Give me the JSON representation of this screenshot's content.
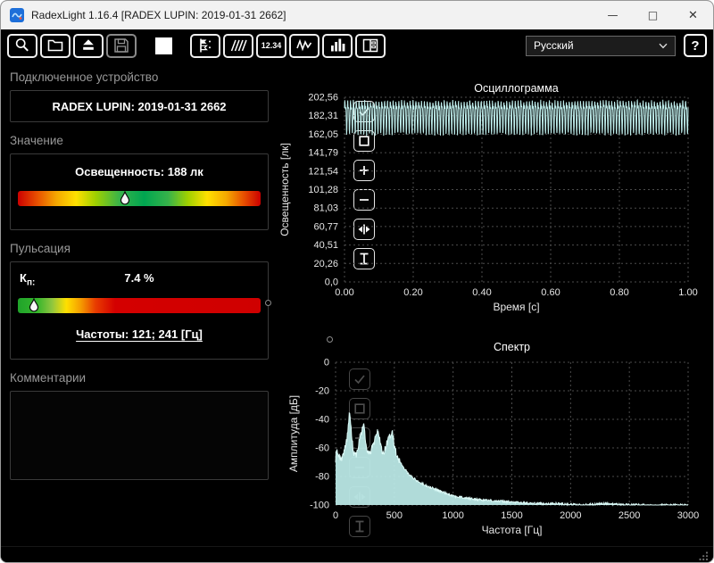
{
  "colors": {
    "accent_cyan": "#bfeeec",
    "grid": "#4c4c4c",
    "panel_header": "#989898",
    "titlebar_bg": "#f2f2f2",
    "scale_green": "#00a651",
    "scale_red": "#cc0000"
  },
  "window": {
    "title": "RadexLight 1.16.4 [RADEX LUPIN: 2019-01-31 2662]",
    "controls": {
      "minimize": "—",
      "maximize": "□",
      "close": "✕"
    }
  },
  "toolbar": {
    "buttons": [
      {
        "name": "search-device",
        "icon": "magnifier-icon"
      },
      {
        "name": "open-file",
        "icon": "folder-open-icon"
      },
      {
        "name": "eject-device",
        "icon": "eject-icon"
      },
      {
        "name": "save-file",
        "icon": "floppy-icon",
        "disabled": true
      },
      {
        "name": "stop-measurement",
        "icon": "stop-icon"
      },
      {
        "name": "markers",
        "icon": "flags-icon"
      },
      {
        "name": "scale",
        "icon": "diagonal-hatch-icon"
      },
      {
        "name": "numeric-view",
        "label": "12.34"
      },
      {
        "name": "oscillogram-view",
        "icon": "waveform-icon"
      },
      {
        "name": "spectrum-view",
        "icon": "bar-chart-icon"
      },
      {
        "name": "layout-view",
        "icon": "panels-icon"
      }
    ],
    "language": {
      "value": "Русский"
    },
    "help_label": "?"
  },
  "device_panel": {
    "header": "Подключенное устройство",
    "device_name": "RADEX LUPIN: 2019-01-31 2662"
  },
  "value_panel": {
    "header": "Значение",
    "reading": "Освещенность: 188 лк",
    "marker_pos_pct": 44
  },
  "pulsation_panel": {
    "header": "Пульсация",
    "kp_label_main": "К",
    "kp_label_sub": "п:",
    "kp_value": "7.4 %",
    "frequencies": "Частоты: 121; 241 [Гц]",
    "marker_pos_pct": 6.5
  },
  "comments_panel": {
    "header": "Комментарии",
    "text": ""
  },
  "chart_overlay_tools": [
    "autoscale",
    "zoom-region",
    "zoom-in",
    "zoom-out",
    "fit-horizontal",
    "fit-vertical"
  ],
  "chart_data": [
    {
      "type": "line",
      "title": "Осциллограмма",
      "xlabel": "Время [с]",
      "ylabel": "Освещенность [лк]",
      "xlim": [
        0,
        1
      ],
      "ylim": [
        0,
        202.56
      ],
      "grid": true,
      "xticks": [
        {
          "v": 0,
          "label": "0.00"
        },
        {
          "v": 0.2,
          "label": "0.20"
        },
        {
          "v": 0.4,
          "label": "0.40"
        },
        {
          "v": 0.6,
          "label": "0.60"
        },
        {
          "v": 0.8,
          "label": "0.80"
        },
        {
          "v": 1,
          "label": "1.00"
        }
      ],
      "yticks": [
        {
          "v": 202.56,
          "label": "202,56"
        },
        {
          "v": 182.31,
          "label": "182,31"
        },
        {
          "v": 162.05,
          "label": "162,05"
        },
        {
          "v": 141.79,
          "label": "141,79"
        },
        {
          "v": 121.54,
          "label": "121,54"
        },
        {
          "v": 101.28,
          "label": "101,28"
        },
        {
          "v": 81.03,
          "label": "81,03"
        },
        {
          "v": 60.77,
          "label": "60,77"
        },
        {
          "v": 40.51,
          "label": "40,51"
        },
        {
          "v": 20.26,
          "label": "20,26"
        },
        {
          "v": 0,
          "label": "0,0"
        }
      ],
      "signal": {
        "mean": 184,
        "components": [
          {
            "freq": 121,
            "amp": 15,
            "phase": 0
          },
          {
            "freq": 242,
            "amp": 7,
            "phase": 1.1
          }
        ],
        "noise": 2
      }
    },
    {
      "type": "area",
      "title": "Спектр",
      "xlabel": "Частота [Гц]",
      "ylabel": "Амплитуда [дБ]",
      "xlim": [
        0,
        3000
      ],
      "ylim": [
        -100,
        0
      ],
      "grid": true,
      "xticks": [
        {
          "v": 0,
          "label": "0"
        },
        {
          "v": 500,
          "label": "500"
        },
        {
          "v": 1000,
          "label": "1000"
        },
        {
          "v": 1500,
          "label": "1500"
        },
        {
          "v": 2000,
          "label": "2000"
        },
        {
          "v": 2500,
          "label": "2500"
        },
        {
          "v": 3000,
          "label": "3000"
        }
      ],
      "yticks": [
        {
          "v": 0,
          "label": "0"
        },
        {
          "v": -20,
          "label": "-20"
        },
        {
          "v": -40,
          "label": "-40"
        },
        {
          "v": -60,
          "label": "-60"
        },
        {
          "v": -80,
          "label": "-80"
        },
        {
          "v": -100,
          "label": "-100"
        }
      ],
      "points": [
        [
          0,
          -70
        ],
        [
          10,
          -58
        ],
        [
          25,
          -66
        ],
        [
          50,
          -68
        ],
        [
          75,
          -62
        ],
        [
          95,
          -55
        ],
        [
          108,
          -44
        ],
        [
          121,
          -33
        ],
        [
          134,
          -48
        ],
        [
          150,
          -62
        ],
        [
          170,
          -66
        ],
        [
          190,
          -60
        ],
        [
          210,
          -52
        ],
        [
          228,
          -46
        ],
        [
          241,
          -40
        ],
        [
          255,
          -55
        ],
        [
          275,
          -64
        ],
        [
          300,
          -62
        ],
        [
          325,
          -57
        ],
        [
          345,
          -52
        ],
        [
          363,
          -47
        ],
        [
          382,
          -58
        ],
        [
          405,
          -64
        ],
        [
          430,
          -58
        ],
        [
          455,
          -53
        ],
        [
          484,
          -50
        ],
        [
          505,
          -60
        ],
        [
          535,
          -68
        ],
        [
          570,
          -73
        ],
        [
          610,
          -77
        ],
        [
          660,
          -81
        ],
        [
          710,
          -84
        ],
        [
          760,
          -86
        ],
        [
          820,
          -88
        ],
        [
          880,
          -90
        ],
        [
          950,
          -92
        ],
        [
          1020,
          -94
        ],
        [
          1100,
          -95
        ],
        [
          1200,
          -96
        ],
        [
          1350,
          -97
        ],
        [
          1500,
          -98
        ],
        [
          1700,
          -99
        ],
        [
          1900,
          -99
        ],
        [
          2100,
          -100
        ],
        [
          2300,
          -99
        ],
        [
          2500,
          -100
        ],
        [
          2750,
          -100
        ],
        [
          3000,
          -100
        ]
      ]
    }
  ]
}
